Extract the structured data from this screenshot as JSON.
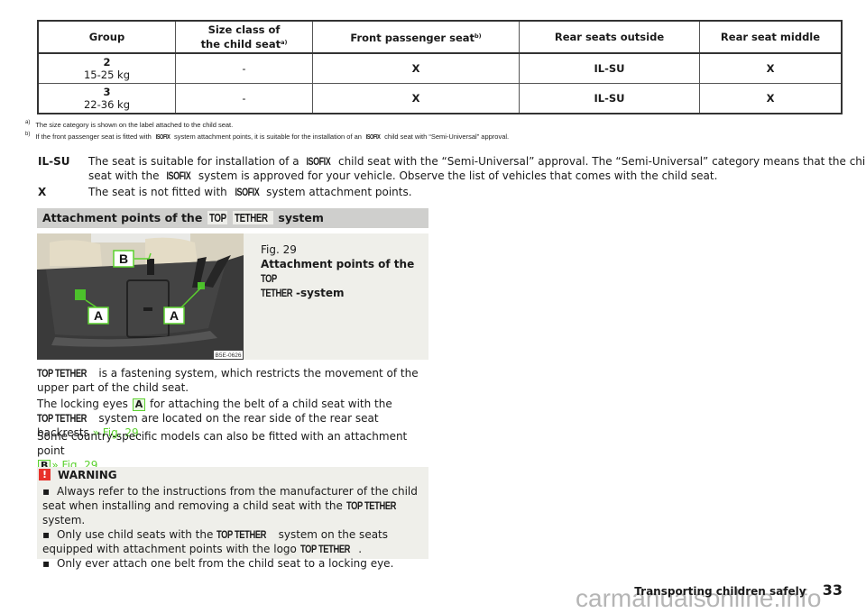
{
  "table": {
    "headers": [
      {
        "text": "Group",
        "sup": ""
      },
      {
        "line1": "Size class of",
        "line2": "the child seat",
        "sup": "a)"
      },
      {
        "text": "Front passenger seat",
        "sup": "b)"
      },
      {
        "text": "Rear seats outside",
        "sup": ""
      },
      {
        "text": "Rear seat middle",
        "sup": ""
      }
    ],
    "rows": [
      {
        "group": "2",
        "weight": "15-25 kg",
        "size_class": "-",
        "front": "X",
        "rear_outside": "IL-SU",
        "rear_middle": "X"
      },
      {
        "group": "3",
        "weight": "22-36 kg",
        "size_class": "-",
        "front": "X",
        "rear_outside": "IL-SU",
        "rear_middle": "X"
      }
    ]
  },
  "footnotes": [
    {
      "mark": "a)",
      "text": "The size category is shown on the label attached to the child seat."
    },
    {
      "mark": "b)",
      "pre": "If the front passenger seat is fitted with",
      "logo": "ISOFIX",
      "mid": "system attachment points, it is suitable for the installation of an",
      "post": "child seat with “Semi-Universal” approval."
    }
  ],
  "legend": [
    {
      "key": "IL-SU",
      "pre": "The seat is suitable for installation of a",
      "logo": "ISOFIX",
      "mid": "child seat with the “Semi-Universal” approval. The “Semi-Universal” category means that the child seat with the",
      "post": "system is approved for your vehicle. Observe the list of vehicles that comes with the child seat."
    },
    {
      "key": "X",
      "pre": "The seat is not fitted with",
      "logo": "ISOFIX",
      "post": "system attachment points."
    }
  ],
  "section": {
    "title_pre": "Attachment points of the",
    "logo1": "TOP",
    "logo2": "TETHER",
    "title_post": "system"
  },
  "figure": {
    "number": "Fig. 29",
    "caption_pre": "Attachment points of the",
    "caption_logo1": "TOP",
    "caption_logo2": "TETHER",
    "caption_post": "-system",
    "image_code": "B5E-0626",
    "callouts": [
      "B",
      "A",
      "A"
    ]
  },
  "paragraphs": {
    "p1_logo": "TOP TETHER",
    "p1_text": "is a fastening system, which restricts the movement of the upper part of the child seat.",
    "p2_pre": "The locking eyes",
    "p2_label": "A",
    "p2_mid": "for attaching the belt of a child seat with the",
    "p2_logo": "TOP TETHER",
    "p2_post": "system are located on the rear side of the rear seat backrests",
    "p2_link": "» Fig. 29",
    "p3_pre": "Some country-specific models can also be fitted with an attachment point",
    "p3_label": "B",
    "p3_link": "» Fig. 29"
  },
  "warning": {
    "icon": "!",
    "title": "WARNING",
    "items": [
      {
        "pre": "Always refer to the instructions from the manufacturer of the child seat when installing and removing a child seat with the",
        "logo": "TOP TETHER",
        "post": "system."
      },
      {
        "pre": "Only use child seats with the",
        "logo": "TOP TETHER",
        "mid": "system on the seats equipped with attachment points with the logo",
        "logo2": "TOP TETHER",
        "post": "."
      },
      {
        "pre": "Only ever attach one belt from the child seat to a locking eye."
      }
    ]
  },
  "footer": {
    "chapter": "Transporting children safely",
    "page": "33",
    "watermark": "carmanualsonline.info"
  },
  "colors": {
    "accent_green": "#5bd12e",
    "warning_red": "#e8312a",
    "section_grey": "#cfcfcd",
    "box_bg": "#efefea"
  }
}
